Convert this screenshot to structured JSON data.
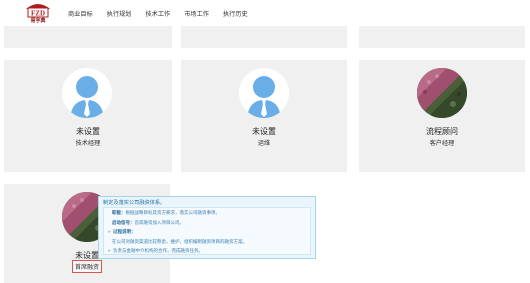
{
  "header": {
    "logo_text": "FZD",
    "logo_sub": "易宇典",
    "nav": [
      "商业目标",
      "执行规划",
      "技术工作",
      "市场工作",
      "执行历史"
    ]
  },
  "cards": [
    {
      "name": "未设置",
      "role": "技术经理",
      "avatar": "default-person"
    },
    {
      "name": "未设置",
      "role": "运维",
      "avatar": "default-person"
    },
    {
      "name": "流程顾问",
      "role": "客户经理",
      "avatar": "landscape-photo"
    },
    {
      "name": "未设置",
      "role": "首席融资",
      "avatar": "landscape-photo"
    }
  ],
  "tooltip": {
    "title": "制定及落实公司融资体系。",
    "lines": [
      {
        "label": "职能：",
        "text": "根据战略目标及资方要求，落实公司融资事项。"
      },
      {
        "label": "启动信号：",
        "text": "首席融资加入项目公司。"
      },
      {
        "label": "过程说明：",
        "text": ""
      },
      {
        "label": "",
        "text": "在公司对融资渠道比较熟悉，维护，组织编制融资项目的融资方案。"
      },
      {
        "label": "",
        "text": "负责与金融中介机构的合作，完成融资任务。"
      }
    ]
  }
}
